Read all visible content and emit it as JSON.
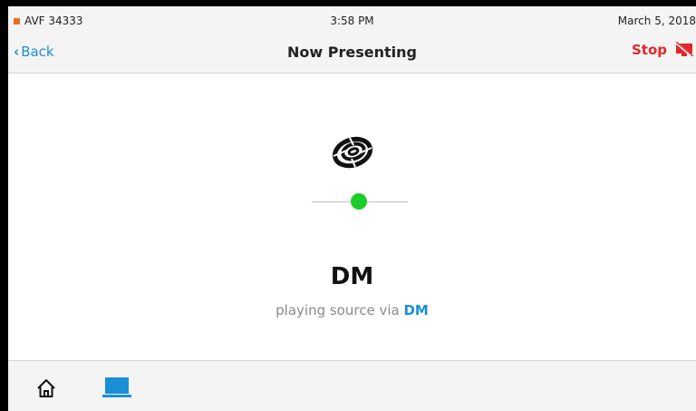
{
  "status": {
    "room_name": "AVF 34333",
    "time": "3:58 PM",
    "date": "March 5, 2018",
    "room_indicator_color": "#f26b1d"
  },
  "nav": {
    "back_label": "Back",
    "back_icon": "chevron-left-icon",
    "title": "Now Presenting",
    "stop_label": "Stop",
    "stop_icon": "display-off-icon"
  },
  "presentation": {
    "logo_icon": "crestron-swirl-icon",
    "signal_status_color": "#1ccc2a",
    "source_name": "DM",
    "subtitle_prefix": "playing source via",
    "subtitle_source": "DM"
  },
  "bottom_nav": {
    "items": [
      {
        "icon": "home-icon"
      },
      {
        "icon": "laptop-icon",
        "active": true
      }
    ]
  },
  "colors": {
    "accent": "#1a8fd6",
    "stop": "#e3282b",
    "bar_background": "#f4f4f4"
  }
}
